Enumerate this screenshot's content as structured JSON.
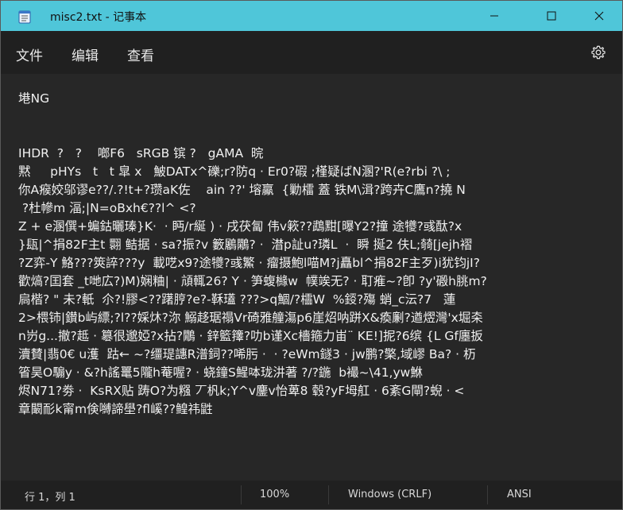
{
  "window": {
    "title": "misc2.txt - 记事本"
  },
  "menu": {
    "file": "文件",
    "edit": "编辑",
    "view": "查看"
  },
  "content": {
    "text": "塂NG\n\n\nIHDR  ?   ?    啷F6   sRGB 镔 ?   gAMA  晥\n黙     pHYs   t   t 皐 x   鮍DATx^礫;r?防q · Er0?碬 ;槿疑ばN溷?'R(e?rbi ?\\ ;\n你A瘊姣邬谬e??/.?!t+?瓒aK佐    ain ??' 塎鸁  {勦檑 蓋 铁M\\湒?跨卉C鷹n?撓 N\n ?杜幓m 湢;|N=oBxh€??l^ <?\nZ + e溷僎+蝙鈷曬瑧}K·  · 眄/r綖 ) · 戌茯匐 伟v簌??鵡黚[曝Y2?撞 途犪?彧酞?x\n}瓺|^捐82F主t 翾 鲒据 · sa?振?v 籔鷵鷴? ·  澘p訨u?璘L  ·  瞬 挻2 伕L;㚡[jejh褶\n?Z弈-Y 鮥???筴誶???y  載呓x9?途犪?彧鰵 · 瘤摄鮑l喵M?j矗bl^捐82F主歹)i犹钧jI?\n歡熇?囯套 _t哋広?)M)娴粬| · 頏輒26? Y · 笋蝮櫞w  幞竢无? · 耵痽~?卽 ?y'磤h朓m?\n扃楷? \" 未?軝  尒?!膠<??躇脝?e?-鞂瓂 ???>q鯝/?櫺W  %鋄?殤 蛸_c沄?7   蓮 \n2>椳铈|鑚b屿縹;?l??婇炑?沵 鰯趍琚禢Vr碕雅艟漡p6崖炤呐跰X&瘓劆?遒熤灣'x堀㚓\nn岃g...撤?趆 · 簒很邈婭?x拈?鷳 · 鋅籃籜?叻b谨Xc檣箍力峀¨ KE!]抳?6缤 {L Gf廛扳\n瀆賛|翡0€ u濩  跍← ~?缰瑅譓R潽鉰??唏肟 ·  · ?eWm鐩3 · jw鹏?檠,域嵺 Ba? · 杤\n箵昊O騸y · &?h謠鼍5隴h菴喔? · 蛲鐘S鯹呠珑汫著 ?/?鍦  b襊~\\41,yw鮴\n烬N71?劵 ·  KsRX贴 踌O?为糨 丆杋k;Y^v鏖v怡萆8 毂?yF坶舡 · 6紊G閘?蜺 · <\n章闞耏k甯m倹嚩諦壆?fl嵠??鳇祎鼪"
  },
  "status": {
    "position": "行 1，列 1",
    "zoom": "100%",
    "line_ending": "Windows (CRLF)",
    "encoding": "ANSI"
  }
}
